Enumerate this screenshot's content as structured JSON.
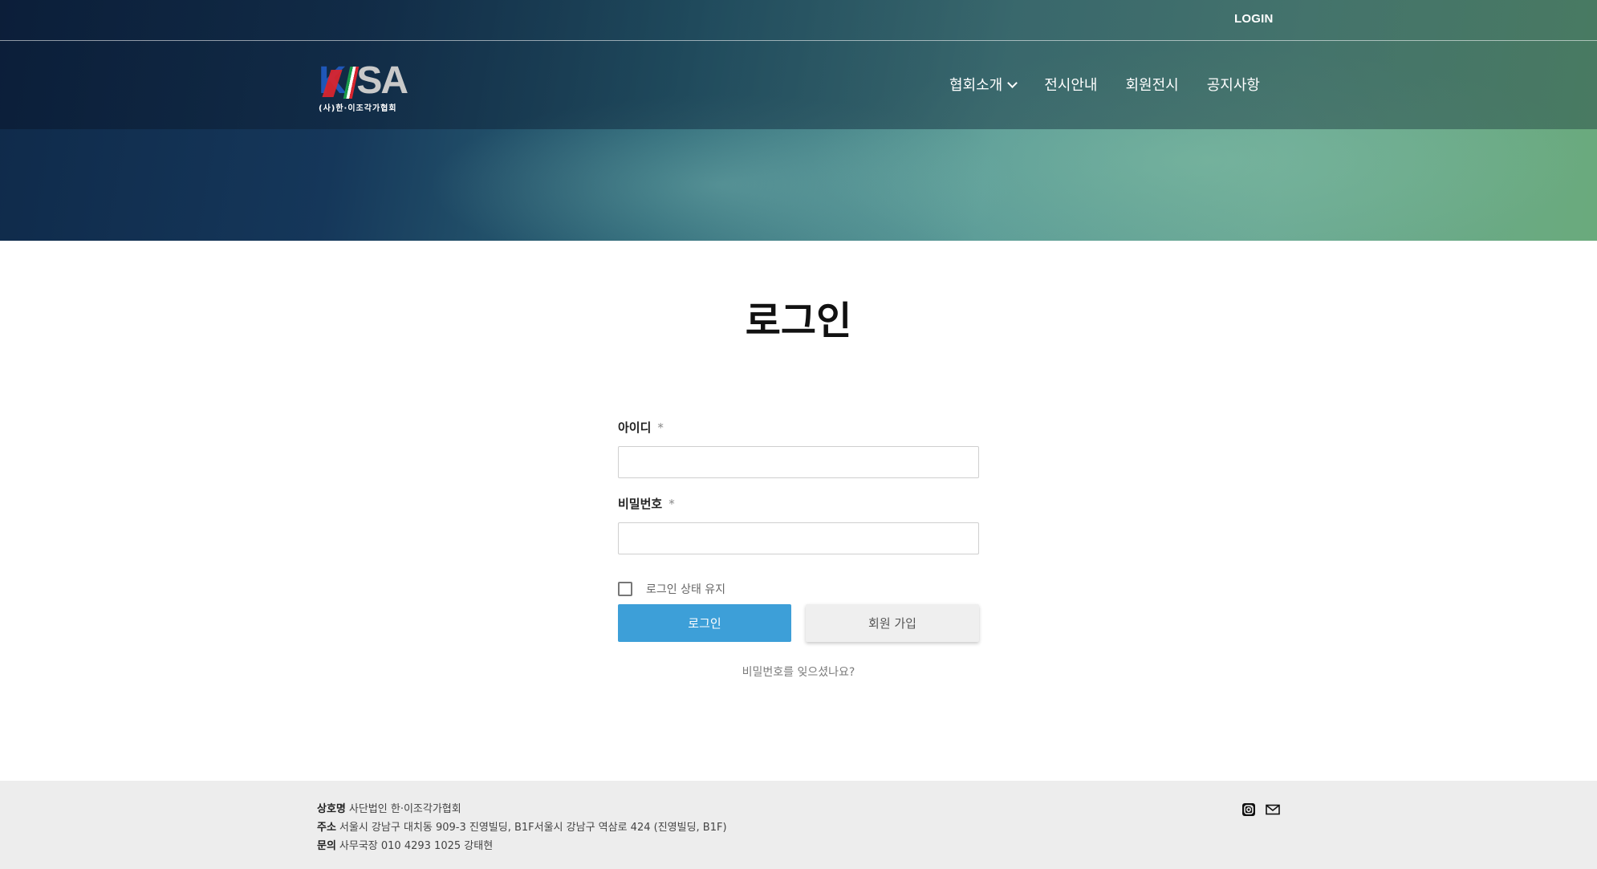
{
  "header": {
    "login_link": "LOGIN",
    "logo_text": "KISA",
    "logo_subtitle": "(사)한·이조각가협회",
    "nav": [
      {
        "label": "협회소개",
        "has_dropdown": true
      },
      {
        "label": "전시안내"
      },
      {
        "label": "회원전시"
      },
      {
        "label": "공지사항"
      }
    ]
  },
  "main": {
    "title": "로그인",
    "username": {
      "label": "아이디",
      "required_mark": "*",
      "value": ""
    },
    "password": {
      "label": "비밀번호",
      "required_mark": "*",
      "value": ""
    },
    "remember": {
      "label": "로그인 상태 유지",
      "checked": false
    },
    "login_button": "로그인",
    "signup_button": "회원 가입",
    "forgot_link": "비밀번호를 잊으셨나요?"
  },
  "footer": {
    "company_label": "상호명",
    "company_value": "사단법인 한·이조각가협회",
    "address_label": "주소",
    "address_value": "서울시 강남구 대치동 909-3 진영빌딩, B1F서울시 강남구 역삼로 424 (진영빌딩, B1F)",
    "contact_label": "문의",
    "contact_value": "사무국장 010 4293 1025 강태현",
    "icons": [
      "instagram-icon",
      "mail-icon"
    ]
  },
  "colors": {
    "primary_button": "#3d9fd8",
    "footer_bg": "#ededed"
  }
}
